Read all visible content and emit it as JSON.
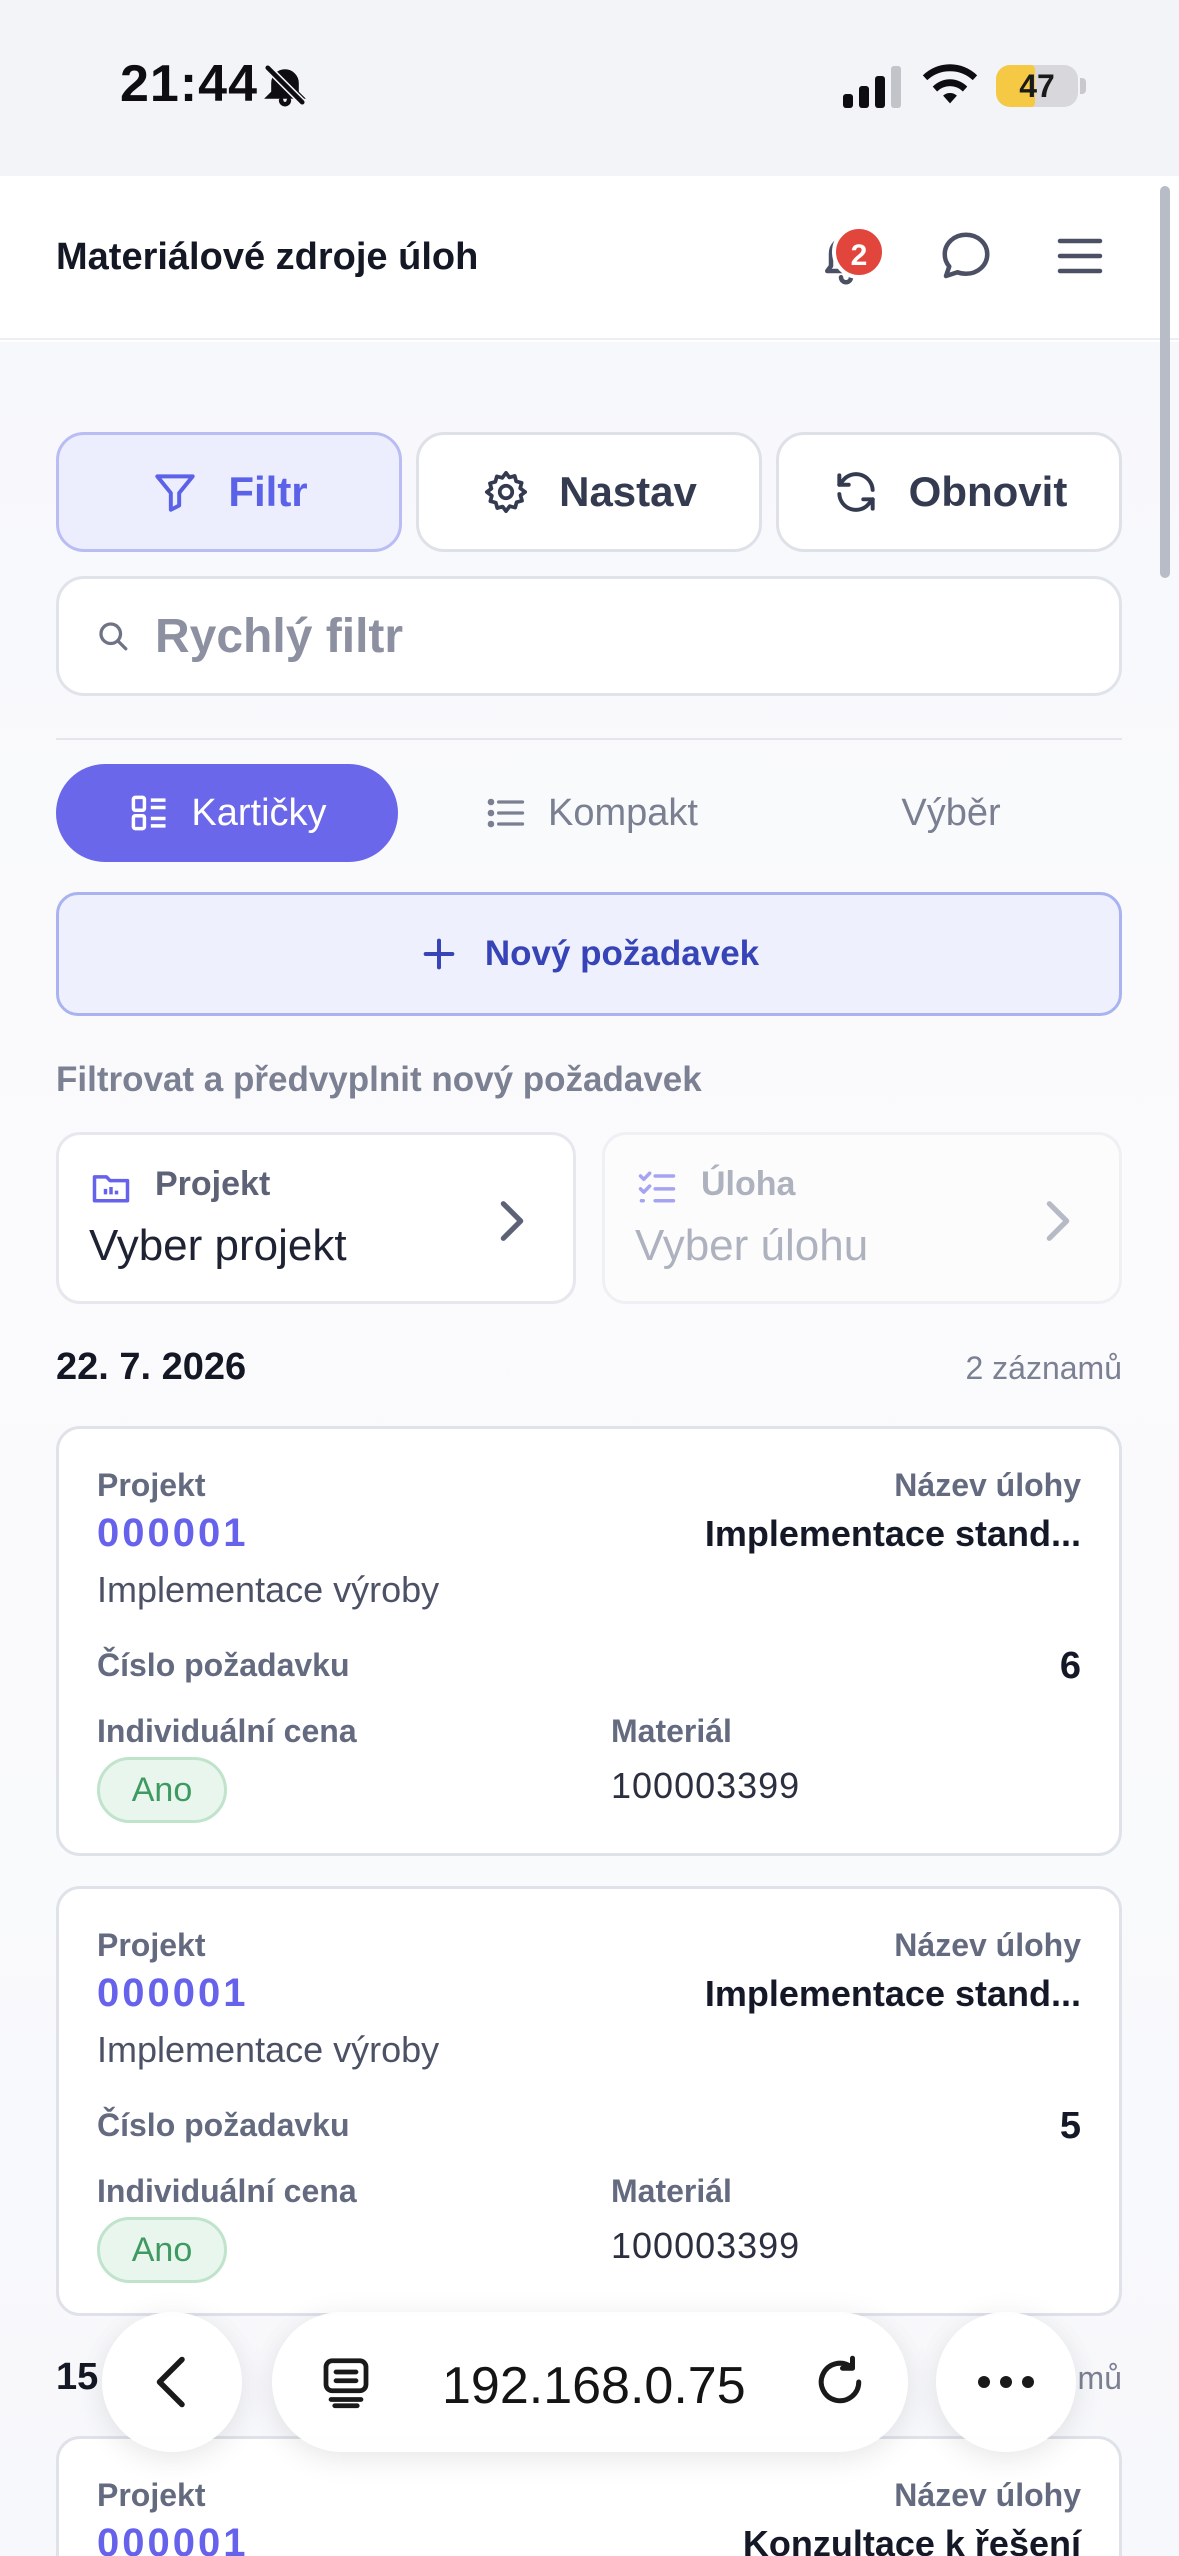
{
  "status": {
    "time": "21:44",
    "battery": "47",
    "battery_level": 0.47
  },
  "header": {
    "title": "Materiálové zdroje úloh",
    "notif_count": "2"
  },
  "toolbar": {
    "filter": "Filtr",
    "settings": "Nastav",
    "refresh": "Obnovit"
  },
  "search": {
    "placeholder": "Rychlý filtr"
  },
  "view_tabs": [
    {
      "label": "Kartičky",
      "active": true
    },
    {
      "label": "Kompakt",
      "active": false
    },
    {
      "label": "Výběr",
      "active": false
    }
  ],
  "new_request": "Nový požadavek",
  "prefill": {
    "label": "Filtrovat a předvyplnit nový požadavek",
    "project": {
      "label": "Projekt",
      "value": "Vyber projekt"
    },
    "task": {
      "label": "Úloha",
      "value": "Vyber úlohu"
    }
  },
  "groups": [
    {
      "date": "22. 7. 2026",
      "count": "2 záznamů",
      "cards": [
        {
          "project_label": "Projekt",
          "project_code": "000001",
          "project_name": "Implementace výroby",
          "task_label": "Název úlohy",
          "task_name": "Implementace stand...",
          "req_label": "Číslo požadavku",
          "req_num": "6",
          "price_label": "Individuální cena",
          "price_value": "Ano",
          "material_label": "Materiál",
          "material": "100003399"
        },
        {
          "project_label": "Projekt",
          "project_code": "000001",
          "project_name": "Implementace výroby",
          "task_label": "Název úlohy",
          "task_name": "Implementace stand...",
          "req_label": "Číslo požadavku",
          "req_num": "5",
          "price_label": "Individuální cena",
          "price_value": "Ano",
          "material_label": "Materiál",
          "material": "100003399"
        }
      ]
    },
    {
      "date": "15",
      "count": "mů",
      "cards": [
        {
          "project_label": "Projekt",
          "project_code": "000001",
          "task_label": "Název úlohy",
          "task_name": "Konzultace k řešení"
        }
      ]
    }
  ],
  "browser": {
    "url": "192.168.0.75"
  }
}
